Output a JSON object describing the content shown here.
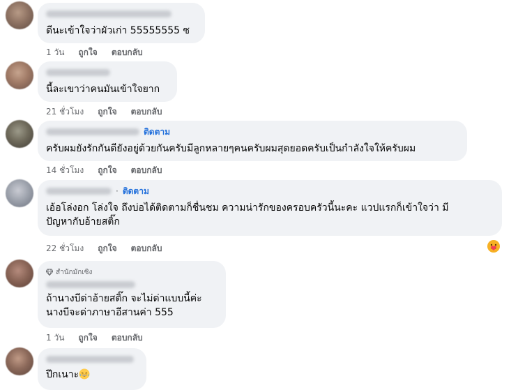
{
  "comments": [
    {
      "text": "ดีนะเข้าใจว่าผัวเก่า 55555555 ซ",
      "time": "1 วัน",
      "like": "ถูกใจ",
      "reply": "ตอบกลับ"
    },
    {
      "text": "นี้ละเขาว่าคนมันเข้าใจยาก",
      "time": "21 ชั่วโมง",
      "like": "ถูกใจ",
      "reply": "ตอบกลับ"
    },
    {
      "follow": "ติดตาม",
      "text": "ครับผมยังรักกันดียังอยู่ด้วยกันครับมีลูกหลายๆคนครับผมสุดยอดครับเป็นกำลังใจให้ครับผม",
      "time": "14 ชั่วโมง",
      "like": "ถูกใจ",
      "reply": "ตอบกลับ"
    },
    {
      "follow": "ติดตาม",
      "dot": "·",
      "text_line1": "เอ้อโล่งอก โล่งใจ ถึงบ่อได้ติดตามก็ชื่นชม ความน่ารักของครอบครัวนี้นะคะ แวปแรกก็เข้าใจว่า มี",
      "text_line2": "ปัญหากับอ้ายสติ๊ก",
      "time": "22 ชั่วโมง",
      "like": "ถูกใจ",
      "reply": "ตอบกลับ",
      "reaction_icon": "care-reaction-icon"
    },
    {
      "badge": "สำนักมักเซิง",
      "text_line1": "ถ้านางบีด่าอ้ายสติ๊ก จะไม่ด่าแบบนี้ค่ะ",
      "text_line2": "นางบีจะด่าภาษาอีสานค่า 555",
      "time": "1 วัน",
      "like": "ถูกใจ",
      "reply": "ตอบกลับ"
    },
    {
      "text": "ปึกเนาะ",
      "emoji": "laughing-emoji"
    }
  ],
  "colors": {
    "bubble": "#f0f2f5",
    "link": "#216fdb",
    "meta": "#65676b",
    "text": "#050505"
  }
}
